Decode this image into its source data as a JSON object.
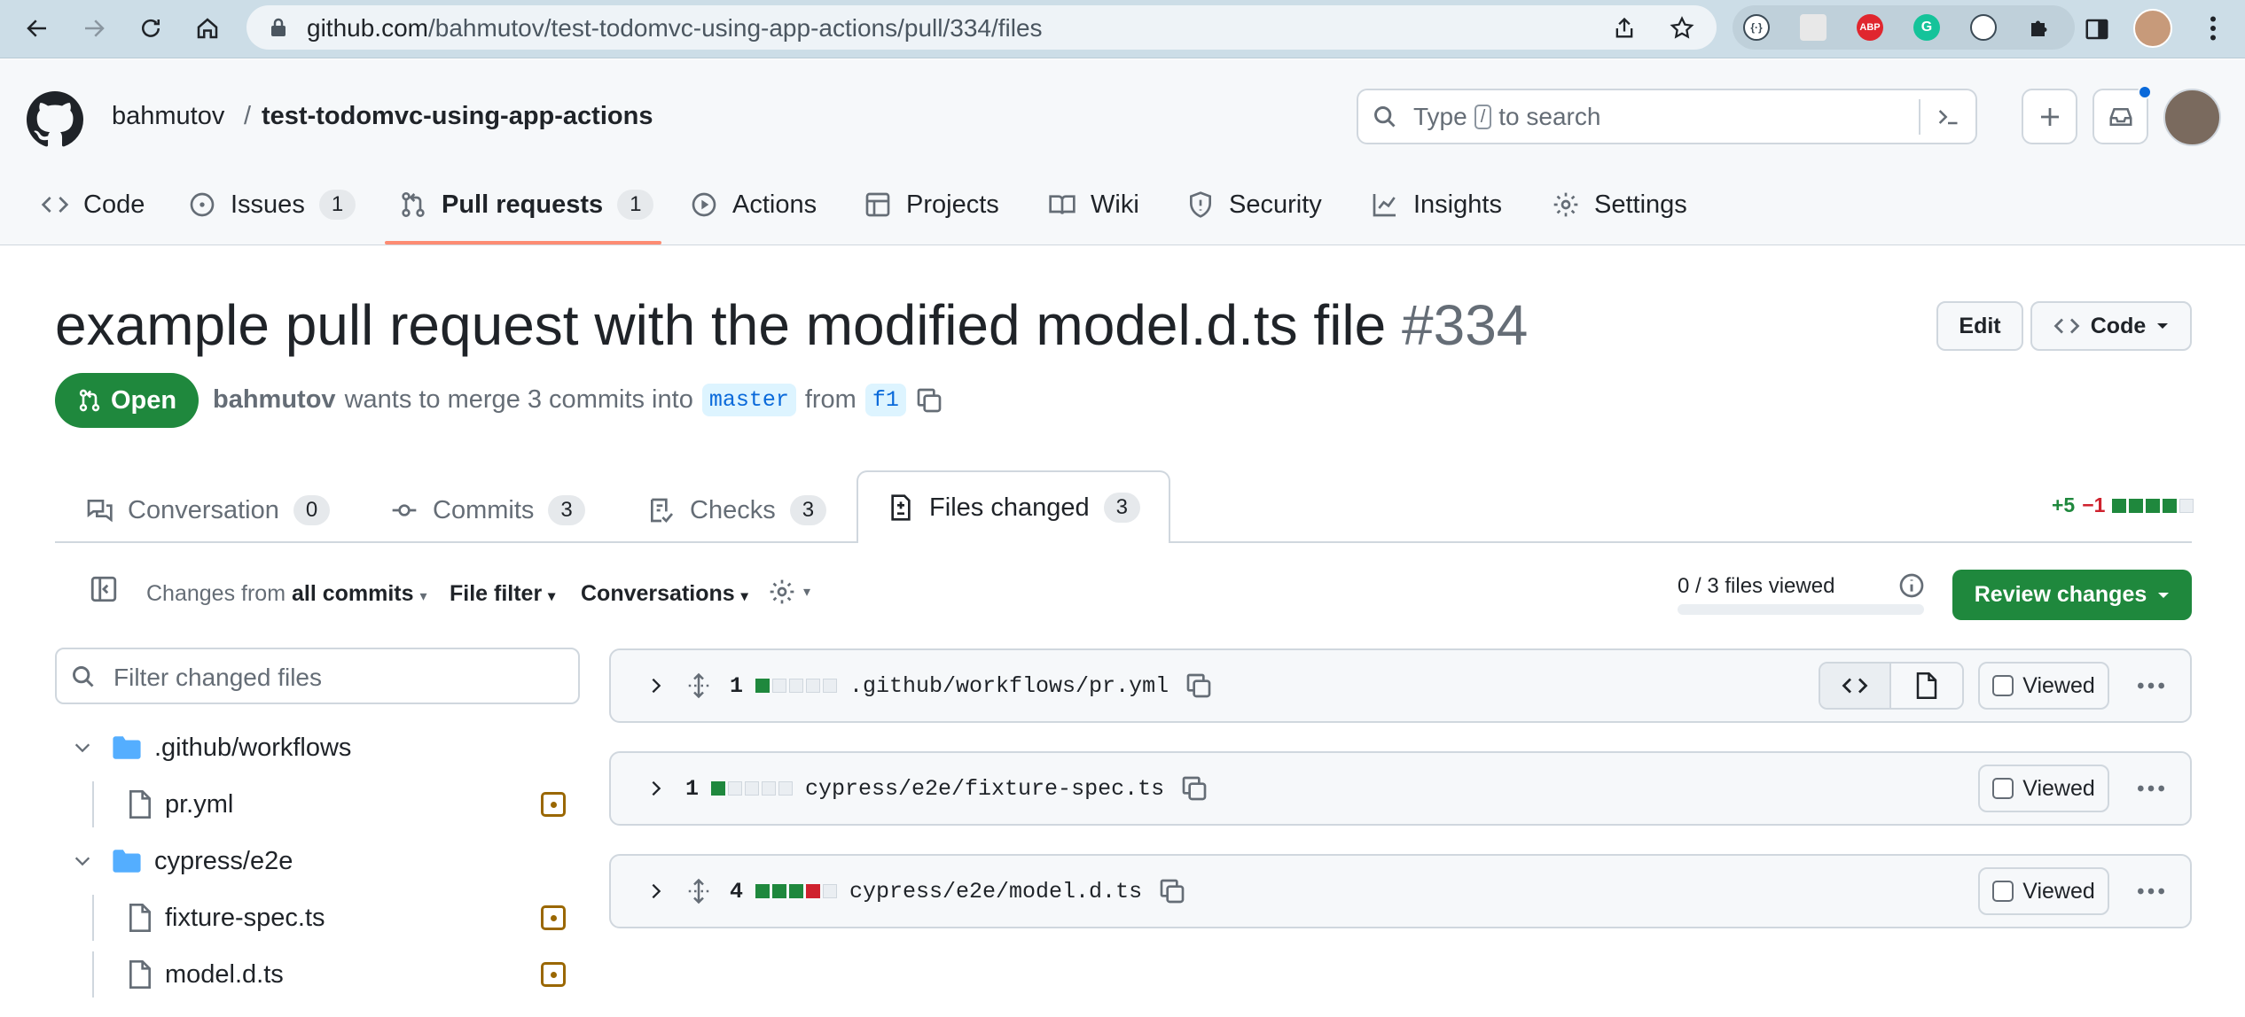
{
  "browser": {
    "url_host": "github.com",
    "url_path": "/bahmutov/test-todomvc-using-app-actions/pull/334/files",
    "extensions": [
      "json-viewer-icon",
      "page-icon",
      "adblock-icon",
      "grammarly-icon",
      "password-icon",
      "puzzle-icon"
    ],
    "ext_labels": {
      "abp": "ABP",
      "grammarly": "G"
    }
  },
  "header": {
    "owner": "bahmutov",
    "separator": "/",
    "repo": "test-todomvc-using-app-actions",
    "search_type": "Type",
    "search_key": "/",
    "search_rest": "to search"
  },
  "repo_nav": [
    {
      "label": "Code",
      "count": null
    },
    {
      "label": "Issues",
      "count": "1"
    },
    {
      "label": "Pull requests",
      "count": "1",
      "active": true
    },
    {
      "label": "Actions",
      "count": null
    },
    {
      "label": "Projects",
      "count": null
    },
    {
      "label": "Wiki",
      "count": null
    },
    {
      "label": "Security",
      "count": null
    },
    {
      "label": "Insights",
      "count": null
    },
    {
      "label": "Settings",
      "count": null
    }
  ],
  "pr": {
    "title": "example pull request with the modified model.d.ts file",
    "number": "#334",
    "state": "Open",
    "author": "bahmutov",
    "meta_text": "wants to merge 3 commits into",
    "base_branch": "master",
    "from_text": "from",
    "head_branch": "f1",
    "edit_label": "Edit",
    "code_label": "Code"
  },
  "pr_tabs": [
    {
      "label": "Conversation",
      "count": "0"
    },
    {
      "label": "Commits",
      "count": "3"
    },
    {
      "label": "Checks",
      "count": "3"
    },
    {
      "label": "Files changed",
      "count": "3",
      "active": true
    }
  ],
  "diffstat_total": {
    "additions": "+5",
    "deletions": "−1"
  },
  "toolbar": {
    "changes_prefix": "Changes from",
    "changes_value": "all commits",
    "file_filter": "File filter",
    "conversations": "Conversations",
    "files_viewed": "0 / 3 files viewed",
    "files_viewed_progress": 0,
    "review_label": "Review changes"
  },
  "file_tree": {
    "filter_placeholder": "Filter changed files",
    "folder1": ".github/workflows",
    "file1": "pr.yml",
    "folder2": "cypress/e2e",
    "file2": "fixture-spec.ts",
    "file3": "model.d.ts"
  },
  "files": [
    {
      "count": "1",
      "name": ".github/workflows/pr.yml",
      "stat": [
        "a",
        "n",
        "n",
        "n",
        "n"
      ],
      "viewed_label": "Viewed"
    },
    {
      "count": "1",
      "name": "cypress/e2e/fixture-spec.ts",
      "stat": [
        "a",
        "n",
        "n",
        "n",
        "n"
      ],
      "viewed_label": "Viewed"
    },
    {
      "count": "4",
      "name": "cypress/e2e/model.d.ts",
      "stat": [
        "a",
        "a",
        "a",
        "d",
        "n"
      ],
      "viewed_label": "Viewed"
    }
  ],
  "colors": {
    "green": "#1f883d",
    "red": "#cf222e",
    "blue": "#0969da",
    "underline": "#fd8c73"
  }
}
